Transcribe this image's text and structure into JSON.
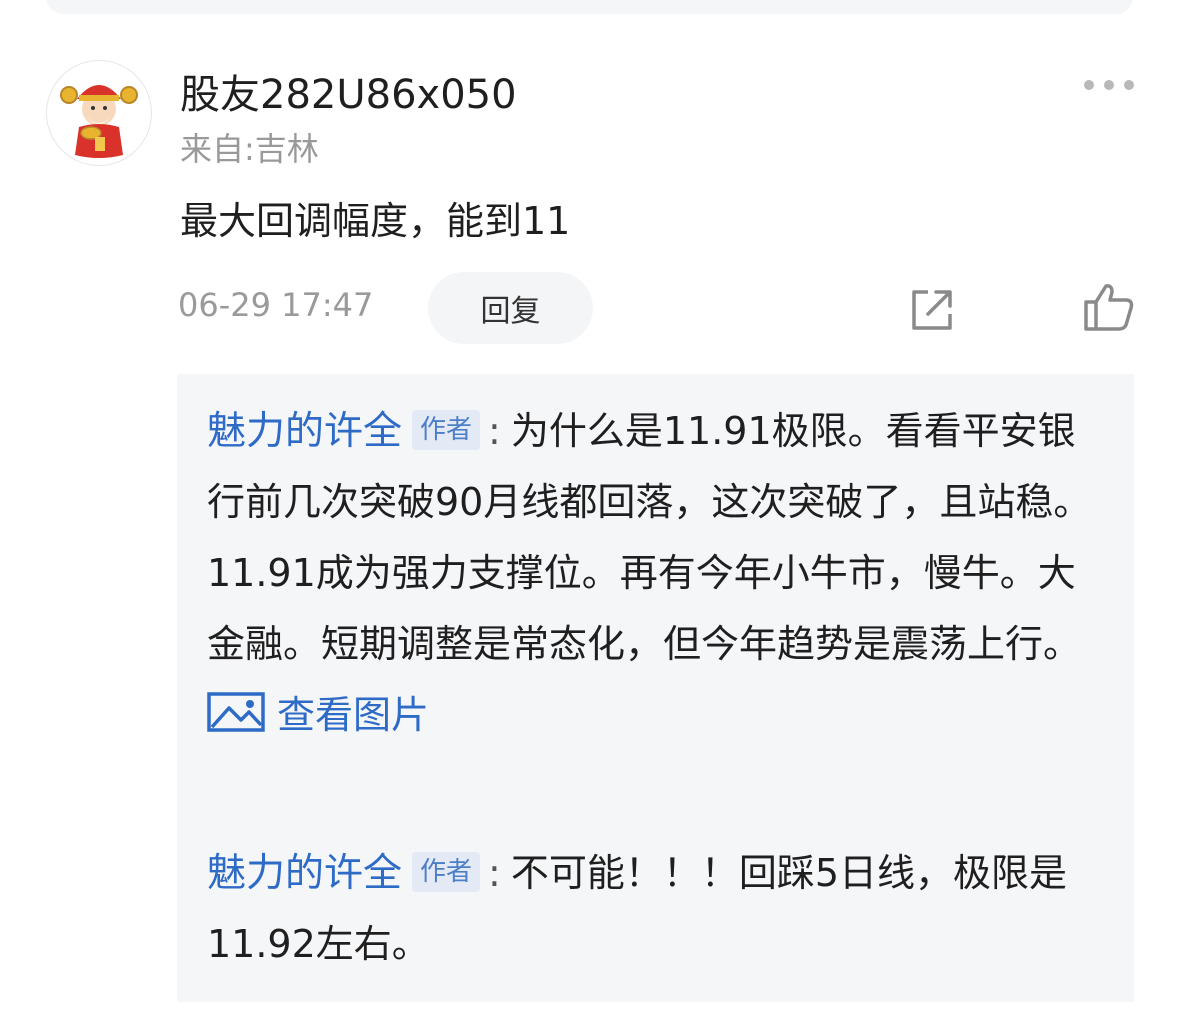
{
  "comment": {
    "username": "股友282U86x050",
    "location": "来自:吉林",
    "text": "最大回调幅度，能到11",
    "timestamp": "06-29 17:47",
    "reply_label": "回复"
  },
  "icons": {
    "more": "more-dots-icon",
    "share": "share-icon",
    "like": "thumbs-up-icon",
    "image": "image-icon"
  },
  "replies": [
    {
      "author": "魅力的许全",
      "badge": "作者",
      "colon": ":",
      "text": "为什么是11.91极限。看看平安银行前几次突破90月线都回落，这次突破了，且站稳。11.91成为强力支撑位。再有今年小牛市，慢牛。大金融。短期调整是常态化，但今年趋势是震荡上行。",
      "link_text": "查看图片"
    },
    {
      "author": "魅力的许全",
      "badge": "作者",
      "colon": ":",
      "text": "不可能！！！回踩5日线，极限是11.92左右。"
    }
  ],
  "colors": {
    "link_blue": "#2e6bc7",
    "reply_bg": "#f5f6f8",
    "muted_text": "#999999"
  }
}
